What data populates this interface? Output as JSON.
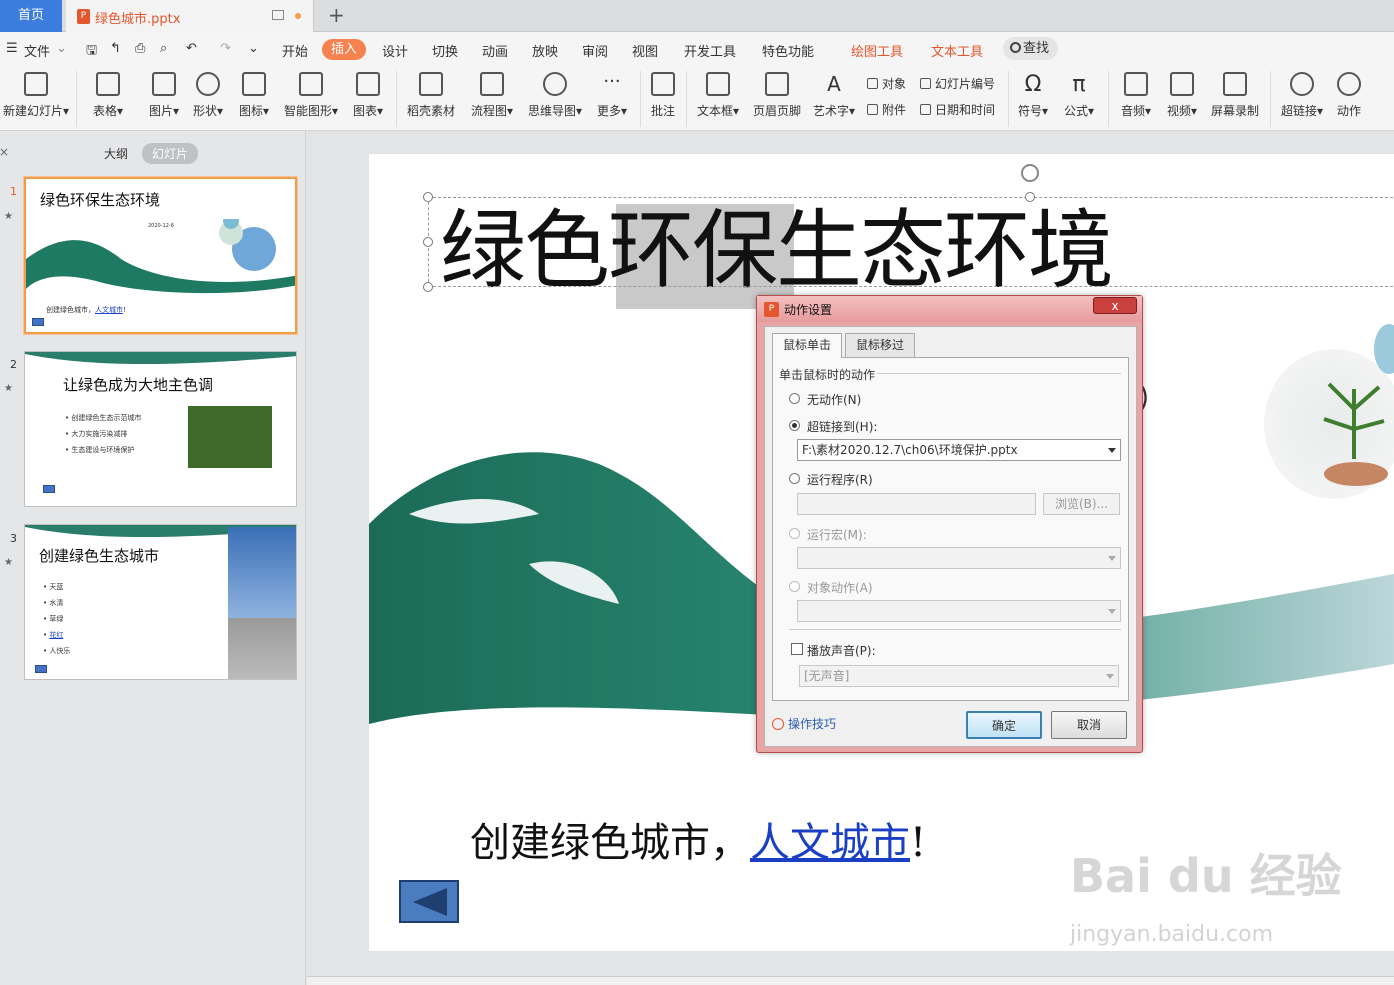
{
  "tabs": {
    "home": "首页",
    "document": "绿色城市.pptx",
    "new": "+"
  },
  "menubar": {
    "file": "文件",
    "items": [
      "开始",
      "插入",
      "设计",
      "切换",
      "动画",
      "放映",
      "审阅",
      "视图",
      "开发工具",
      "特色功能"
    ],
    "active": "插入",
    "context_tabs": [
      "绘图工具",
      "文本工具"
    ],
    "search": "查找"
  },
  "ribbon": {
    "new_slide": "新建幻灯片",
    "table": "表格",
    "picture": "图片",
    "shape": "形状",
    "icon": "图标",
    "smartart": "智能图形",
    "chart": "图表",
    "material": "稻壳素材",
    "flowchart": "流程图",
    "mindmap": "思维导图",
    "more": "更多",
    "comment": "批注",
    "textbox": "文本框",
    "header_footer": "页眉页脚",
    "wordart": "艺术字",
    "object": "对象",
    "slide_number": "幻灯片编号",
    "attachment": "附件",
    "date_time": "日期和时间",
    "symbol": "符号",
    "formula": "公式",
    "audio": "音频",
    "video": "视频",
    "screen_record": "屏幕录制",
    "hyperlink": "超链接",
    "action": "动作",
    "close_glyph": "×"
  },
  "panel": {
    "outline": "大纲",
    "slides": "幻灯片"
  },
  "thumbnails": [
    {
      "num": "1",
      "title": "绿色环保生态环境",
      "date": "2020-12-6",
      "subtitle_prefix": "创建绿色城市，",
      "subtitle_link": "人文城市",
      "subtitle_suffix": "!"
    },
    {
      "num": "2",
      "title": "让绿色成为大地主色调",
      "bullets": [
        "创建绿色生态示范城市",
        "大力实施污染减排",
        "生态建设与环境保护"
      ]
    },
    {
      "num": "3",
      "title": "创建绿色生态城市",
      "bullets": [
        "天蓝",
        "水清",
        "草绿",
        "花红",
        "人快乐"
      ]
    }
  ],
  "slide": {
    "title": "绿色环保生态环境",
    "subtitle_prefix": "创建绿色城市，",
    "subtitle_link": "人文城市",
    "subtitle_suffix": "!",
    "stray_text": "）"
  },
  "dialog": {
    "title": "动作设置",
    "close": "x",
    "tabs": [
      "鼠标单击",
      "鼠标移过"
    ],
    "group_label": "单击鼠标时的动作",
    "options": {
      "none": "无动作(N)",
      "hyperlink": "超链接到(H):",
      "run_program": "运行程序(R)",
      "run_macro": "运行宏(M):",
      "object_action": "对象动作(A)"
    },
    "hyperlink_value": "F:\\素材2020.12.7\\ch06\\环境保护.pptx",
    "browse": "浏览(B)...",
    "play_sound": "播放声音(P):",
    "sound_value": "[无声音]",
    "tips": "操作技巧",
    "ok": "确定",
    "cancel": "取消"
  },
  "watermark": {
    "brand": "Bai du 经验",
    "url": "jingyan.baidu.com"
  },
  "colors": {
    "accent": "#e4572e",
    "active_tab": "#f6824f",
    "home_tab": "#3b7ddd",
    "link": "#1a44c9",
    "thumb_selected": "#f39c4a"
  }
}
